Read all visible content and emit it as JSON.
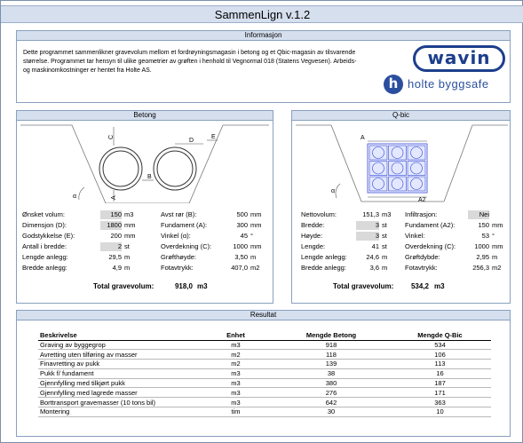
{
  "app": {
    "title": "SammenLign v.1.2"
  },
  "info": {
    "header": "Informasjon",
    "text": "Dette programmet sammenlikner gravevolum mellom et fordrøyningsmagasin i betong og et Qbic-magasin av tilsvarende størrelse. Programmet tar hensyn til ulike geometrier av grøften i henhold til Vegnormal 018 (Statens Vegvesen). Arbeids- og maskinomkostninger er hentet fra Holte AS.",
    "logo_wavin": "wavin",
    "logo_holte_mark": "h",
    "logo_holte_text": "holte byggsafe"
  },
  "betong": {
    "header": "Betong",
    "diagram_labels": {
      "c": "C",
      "d": "D",
      "e": "E",
      "a": "A",
      "b": "B",
      "angle": "α"
    },
    "left": [
      {
        "label": "Ønsket volum:",
        "value": "150",
        "unit": "m3",
        "input": true
      },
      {
        "label": "Dimensjon (D):",
        "value": "1800",
        "unit": "mm",
        "input": true
      },
      {
        "label": "Godstykkelse (E):",
        "value": "200",
        "unit": "mm",
        "input": false
      },
      {
        "label": "Antall i bredde:",
        "value": "2",
        "unit": "st",
        "input": true
      },
      {
        "label": "Lengde anlegg:",
        "value": "29,5",
        "unit": "m",
        "input": false
      },
      {
        "label": "Bredde anlegg:",
        "value": "4,9",
        "unit": "m",
        "input": false
      }
    ],
    "right": [
      {
        "label": "Avst rør (B):",
        "value": "500",
        "unit": "mm"
      },
      {
        "label": "Fundament (A):",
        "value": "300",
        "unit": "mm"
      },
      {
        "label": "Vinkel (α):",
        "value": "45",
        "unit": "°"
      },
      {
        "label": "Overdekning (C):",
        "value": "1000",
        "unit": "mm"
      },
      {
        "label": "Grøfthøyde:",
        "value": "3,50",
        "unit": "m"
      },
      {
        "label": "Fotavtrykk:",
        "value": "407,0",
        "unit": "m2"
      }
    ],
    "total_label": "Total gravevolum:",
    "total_value": "918,0",
    "total_unit": "m3"
  },
  "qbic": {
    "header": "Q-bic",
    "diagram_labels": {
      "a": "A",
      "a2": "A2",
      "angle": "α"
    },
    "left": [
      {
        "label": "Nettovolum:",
        "value": "151,3",
        "unit": "m3",
        "input": false
      },
      {
        "label": "Bredde:",
        "value": "3",
        "unit": "st",
        "input": true
      },
      {
        "label": "Høyde:",
        "value": "3",
        "unit": "st",
        "input": true
      },
      {
        "label": "Lengde:",
        "value": "41",
        "unit": "st",
        "input": false
      },
      {
        "label": "Lengde anlegg:",
        "value": "24,6",
        "unit": "m",
        "input": false
      },
      {
        "label": "Bredde anlegg:",
        "value": "3,6",
        "unit": "m",
        "input": false
      }
    ],
    "right": [
      {
        "label": "Infiltrasjon:",
        "value": "Nei",
        "unit": "",
        "input": true
      },
      {
        "label": "Fundament (A2):",
        "value": "150",
        "unit": "mm",
        "input": false
      },
      {
        "label": "Vinkel:",
        "value": "53",
        "unit": "°",
        "input": false
      },
      {
        "label": "Overdekning (C):",
        "value": "1000",
        "unit": "mm",
        "input": false
      },
      {
        "label": "Grøftdybde:",
        "value": "2,95",
        "unit": "m",
        "input": false
      },
      {
        "label": "Fotavtrykk:",
        "value": "256,3",
        "unit": "m2",
        "input": false
      }
    ],
    "total_label": "Total gravevolum:",
    "total_value": "534,2",
    "total_unit": "m3"
  },
  "result": {
    "header": "Resultat",
    "columns": [
      "Beskrivelse",
      "Enhet",
      "Mengde Betong",
      "Mengde Q-Bic"
    ],
    "rows": [
      [
        "Graving av byggegrop",
        "m3",
        "918",
        "534"
      ],
      [
        "Avretting uten tilføring av masser",
        "m2",
        "118",
        "106"
      ],
      [
        "Finavretting av pukk",
        "m2",
        "139",
        "113"
      ],
      [
        "Pukk f/ fundament",
        "m3",
        "38",
        "16"
      ],
      [
        "Gjennfylling med tilkjørt pukk",
        "m3",
        "380",
        "187"
      ],
      [
        "Gjennfylling med lagrede masser",
        "m3",
        "276",
        "171"
      ],
      [
        "Borttransport gravemasser (10 tons bil)",
        "m3",
        "642",
        "363"
      ],
      [
        "Montering",
        "tim",
        "30",
        "10"
      ]
    ]
  },
  "colors": {
    "header_bg": "#d5dfee",
    "border": "#8aa0bd",
    "logo_blue": "#1c3e8c",
    "qbic_blue": "#2f43d6"
  }
}
